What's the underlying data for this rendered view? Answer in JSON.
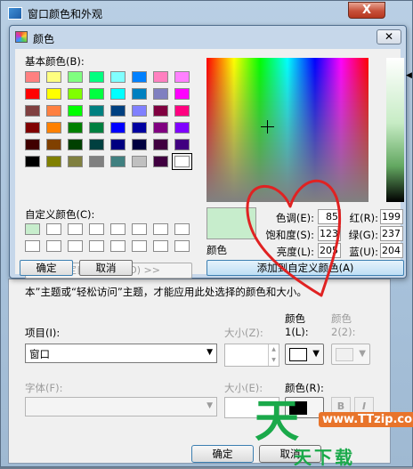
{
  "back_window": {
    "title": "窗口颜色和外观",
    "close_symbol": "X",
    "info_text": "本”主题或“轻松访问”主题，才能应用此处选择的颜色和大小。",
    "item_label": "项目(I):",
    "item_value": "窗口",
    "size1_label": "大小(Z):",
    "color1_label": "颜色1(L):",
    "color2_label": "颜色2(2):",
    "font_label": "字体(F):",
    "size2_label": "大小(E):",
    "color_r_label": "颜色(R):",
    "bold_symbol": "B",
    "italic_symbol": "I",
    "ok_label": "确定",
    "cancel_label": "取消"
  },
  "dialog": {
    "title": "颜色",
    "close_symbol": "✕",
    "basic_colors_label": "基本颜色(B):",
    "custom_colors_label": "自定义颜色(C):",
    "define_custom_label": "规定自定义颜色(D) >>",
    "ok_label": "确定",
    "cancel_label": "取消",
    "preview_label": "颜色",
    "add_custom_label": "添加到自定义颜色(A)",
    "basic_colors": [
      "#ff8080",
      "#ffff80",
      "#80ff80",
      "#00ff80",
      "#80ffff",
      "#0080ff",
      "#ff80c0",
      "#ff80ff",
      "#ff0000",
      "#ffff00",
      "#80ff00",
      "#00ff40",
      "#00ffff",
      "#0080c0",
      "#8080c0",
      "#ff00ff",
      "#804040",
      "#ff8040",
      "#00ff00",
      "#008080",
      "#004080",
      "#8080ff",
      "#800040",
      "#ff0080",
      "#800000",
      "#ff8000",
      "#008000",
      "#008040",
      "#0000ff",
      "#0000a0",
      "#800080",
      "#8000ff",
      "#400000",
      "#804000",
      "#004000",
      "#004040",
      "#000080",
      "#000040",
      "#400040",
      "#400080",
      "#000000",
      "#808000",
      "#808040",
      "#808080",
      "#408080",
      "#c0c0c0",
      "#400040",
      "#ffffff"
    ],
    "custom_colors": [
      "#c7edcc",
      "#ffffff",
      "#ffffff",
      "#ffffff",
      "#ffffff",
      "#ffffff",
      "#ffffff",
      "#ffffff",
      "#ffffff",
      "#ffffff",
      "#ffffff",
      "#ffffff",
      "#ffffff",
      "#ffffff",
      "#ffffff",
      "#ffffff"
    ],
    "fields": {
      "hue": {
        "label": "色调(E):",
        "value": "85"
      },
      "sat": {
        "label": "饱和度(S):",
        "value": "123"
      },
      "lum": {
        "label": "亮度(L):",
        "value": "205"
      },
      "red": {
        "label": "红(R):",
        "value": "199"
      },
      "green": {
        "label": "绿(G):",
        "value": "237"
      },
      "blue": {
        "label": "蓝(U):",
        "value": "204"
      }
    },
    "preview_color": "#c7edcc"
  },
  "watermark": {
    "logo": "天",
    "url": "www.TTzip.com",
    "text": "天下载"
  }
}
